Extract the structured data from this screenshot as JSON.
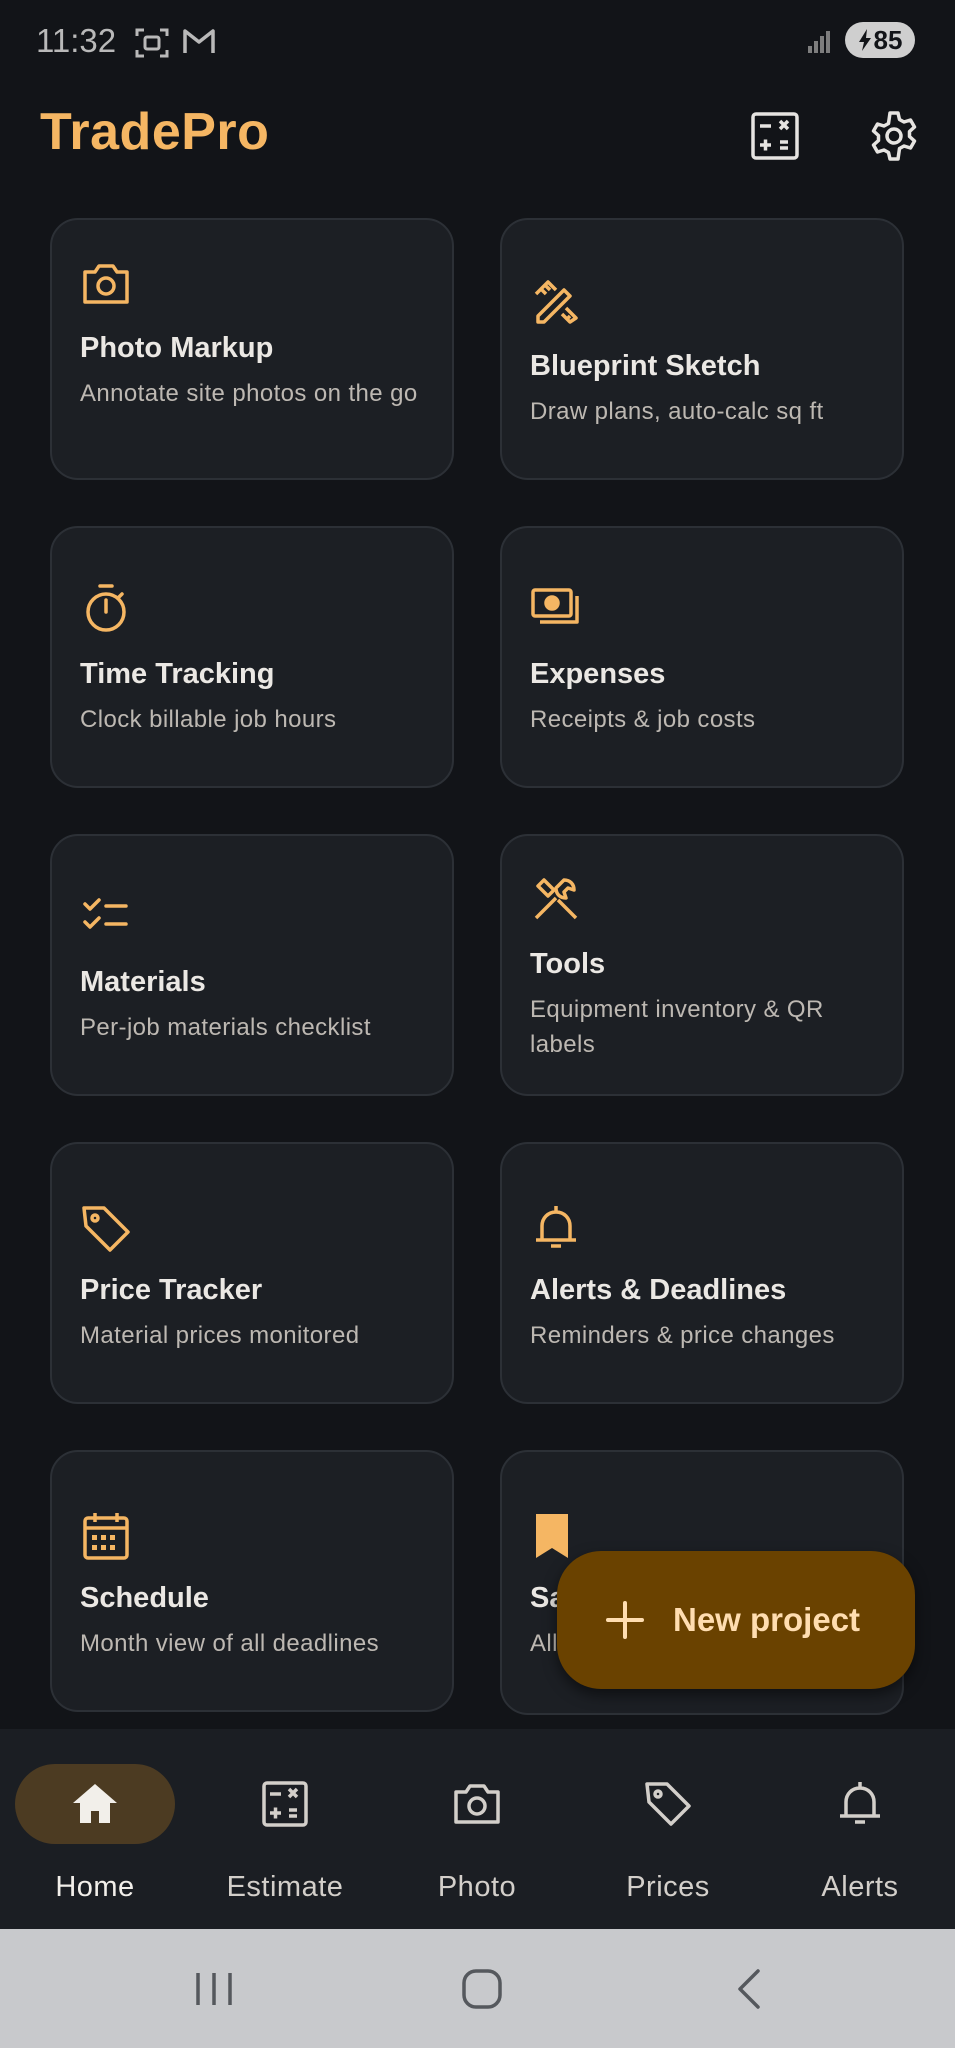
{
  "status_bar": {
    "time": "11:32",
    "battery": "85",
    "left_icons": [
      "screenshot-icon",
      "gmail-icon"
    ],
    "right_icons": [
      "signal-icon",
      "battery-charging-icon"
    ]
  },
  "header": {
    "title": "TradePro",
    "actions": [
      "calculator-icon",
      "settings-gear-icon"
    ]
  },
  "colors": {
    "accent": "#f5b663",
    "background": "#121418",
    "card": "#1c1f24",
    "fab": "#6a4200",
    "nav_active_pill": "#4c3b22"
  },
  "cards": [
    {
      "title": "Photo Markup",
      "subtitle": "Annotate site photos on the go",
      "icon": "camera-icon"
    },
    {
      "title": "Blueprint Sketch",
      "subtitle": "Draw plans, auto-calc sq ft",
      "icon": "pencil-ruler-icon"
    },
    {
      "title": "Time Tracking",
      "subtitle": "Clock billable job hours",
      "icon": "stopwatch-icon"
    },
    {
      "title": "Expenses",
      "subtitle": "Receipts & job costs",
      "icon": "money-icon"
    },
    {
      "title": "Materials",
      "subtitle": "Per-job materials checklist",
      "icon": "checklist-icon"
    },
    {
      "title": "Tools",
      "subtitle": "Equipment inventory & QR labels",
      "icon": "hammer-wrench-icon"
    },
    {
      "title": "Price Tracker",
      "subtitle": "Material prices monitored",
      "icon": "price-tag-icon"
    },
    {
      "title": "Alerts & Deadlines",
      "subtitle": "Reminders & price changes",
      "icon": "bell-icon"
    },
    {
      "title": "Schedule",
      "subtitle": "Month view of all deadlines",
      "icon": "calendar-icon"
    },
    {
      "title": "Sa",
      "subtitle": "All",
      "icon": "bookmark-icon"
    }
  ],
  "fab": {
    "label": "New project",
    "icon": "plus-icon"
  },
  "bottom_nav": {
    "active": "Home",
    "items": [
      {
        "label": "Home",
        "icon": "home-icon"
      },
      {
        "label": "Estimate",
        "icon": "calculator-icon"
      },
      {
        "label": "Photo",
        "icon": "camera-icon"
      },
      {
        "label": "Prices",
        "icon": "price-tag-icon"
      },
      {
        "label": "Alerts",
        "icon": "bell-icon"
      }
    ]
  },
  "system_nav": [
    "recents-icon",
    "home-circle-icon",
    "back-icon"
  ]
}
